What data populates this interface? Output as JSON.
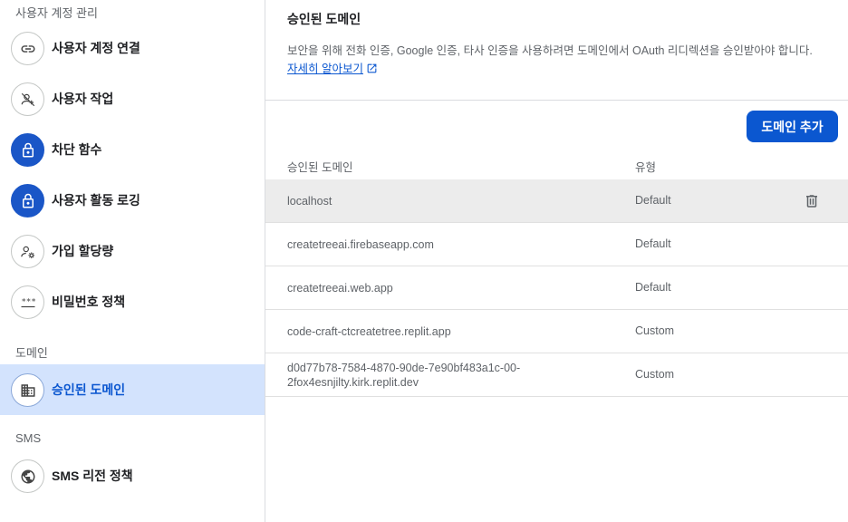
{
  "sidebar": {
    "section_user_account": "사용자 계정 관리",
    "section_domain": "도메인",
    "section_sms": "SMS",
    "items": [
      {
        "label": "사용자 계정 연결",
        "icon": "link-icon"
      },
      {
        "label": "사용자 작업",
        "icon": "person-off-icon"
      },
      {
        "label": "차단 함수",
        "icon": "lock-icon"
      },
      {
        "label": "사용자 활동 로깅",
        "icon": "lock-icon"
      },
      {
        "label": "가입 할당량",
        "icon": "manage-accounts-icon"
      },
      {
        "label": "비밀번호 정책",
        "icon": "password-icon"
      },
      {
        "label": "승인된 도메인",
        "icon": "domain-icon"
      },
      {
        "label": "SMS 리전 정책",
        "icon": "globe-icon"
      }
    ]
  },
  "main": {
    "title": "승인된 도메인",
    "description": "보안을 위해 전화 인증, Google 인증, 타사 인증을 사용하려면 도메인에서 OAuth 리디렉션을 승인받아야 합니다.",
    "learn_more": "자세히 알아보기",
    "add_button": "도메인 추가",
    "table": {
      "headers": {
        "domain": "승인된 도메인",
        "type": "유형"
      },
      "rows": [
        {
          "domain": "localhost",
          "type": "Default"
        },
        {
          "domain": "createtreeai.firebaseapp.com",
          "type": "Default"
        },
        {
          "domain": "createtreeai.web.app",
          "type": "Default"
        },
        {
          "domain": "code-craft-ctcreatetree.replit.app",
          "type": "Custom"
        },
        {
          "domain_line1": "d0d77b78-7584-4870-90de-7e90bf483a1c-00-",
          "domain_line2": "2fox4esnjilty.kirk.replit.dev",
          "type": "Custom"
        }
      ]
    }
  },
  "colors": {
    "accent": "#0b57d0",
    "active_bg": "#d3e3fd",
    "filled_icon": "#1a56c7"
  }
}
